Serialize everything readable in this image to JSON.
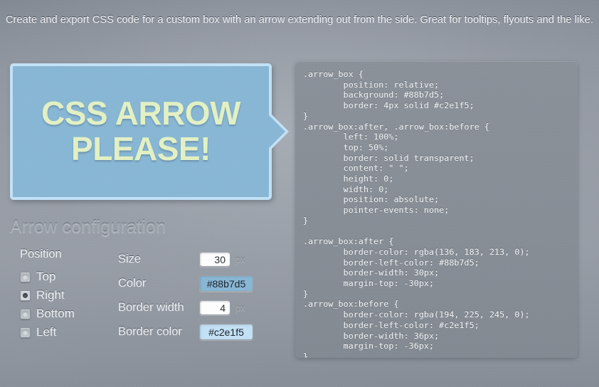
{
  "header": {
    "tagline": "Create and export CSS code for a custom box with an arrow extending out from the side. Great for tooltips, flyouts and the like."
  },
  "preview": {
    "text_line1": "CSS ARROW",
    "text_line2": "PLEASE!",
    "background_color": "#88b7d5",
    "border_color": "#c2e1f5"
  },
  "config": {
    "heading": "Arrow configuration",
    "position": {
      "label": "Position",
      "options": [
        {
          "label": "Top",
          "selected": false
        },
        {
          "label": "Right",
          "selected": true
        },
        {
          "label": "Bottom",
          "selected": false
        },
        {
          "label": "Left",
          "selected": false
        }
      ],
      "selected_value": "Right"
    },
    "fields": [
      {
        "label": "Size",
        "value": "30",
        "unit": "px",
        "type": "number"
      },
      {
        "label": "Color",
        "value": "#88b7d5",
        "unit": "",
        "type": "color"
      },
      {
        "label": "Border width",
        "value": "4",
        "unit": "px",
        "type": "number"
      },
      {
        "label": "Border color",
        "value": "#c2e1f5",
        "unit": "",
        "type": "color"
      }
    ]
  },
  "code_panel": {
    "css": ".arrow_box {\n        position: relative;\n        background: #88b7d5;\n        border: 4px solid #c2e1f5;\n}\n.arrow_box:after, .arrow_box:before {\n        left: 100%;\n        top: 50%;\n        border: solid transparent;\n        content: \" \";\n        height: 0;\n        width: 0;\n        position: absolute;\n        pointer-events: none;\n}\n\n.arrow_box:after {\n        border-color: rgba(136, 183, 213, 0);\n        border-left-color: #88b7d5;\n        border-width: 30px;\n        margin-top: -30px;\n}\n.arrow_box:before {\n        border-color: rgba(194, 225, 245, 0);\n        border-left-color: #c2e1f5;\n        border-width: 36px;\n        margin-top: -36px;\n}"
  }
}
